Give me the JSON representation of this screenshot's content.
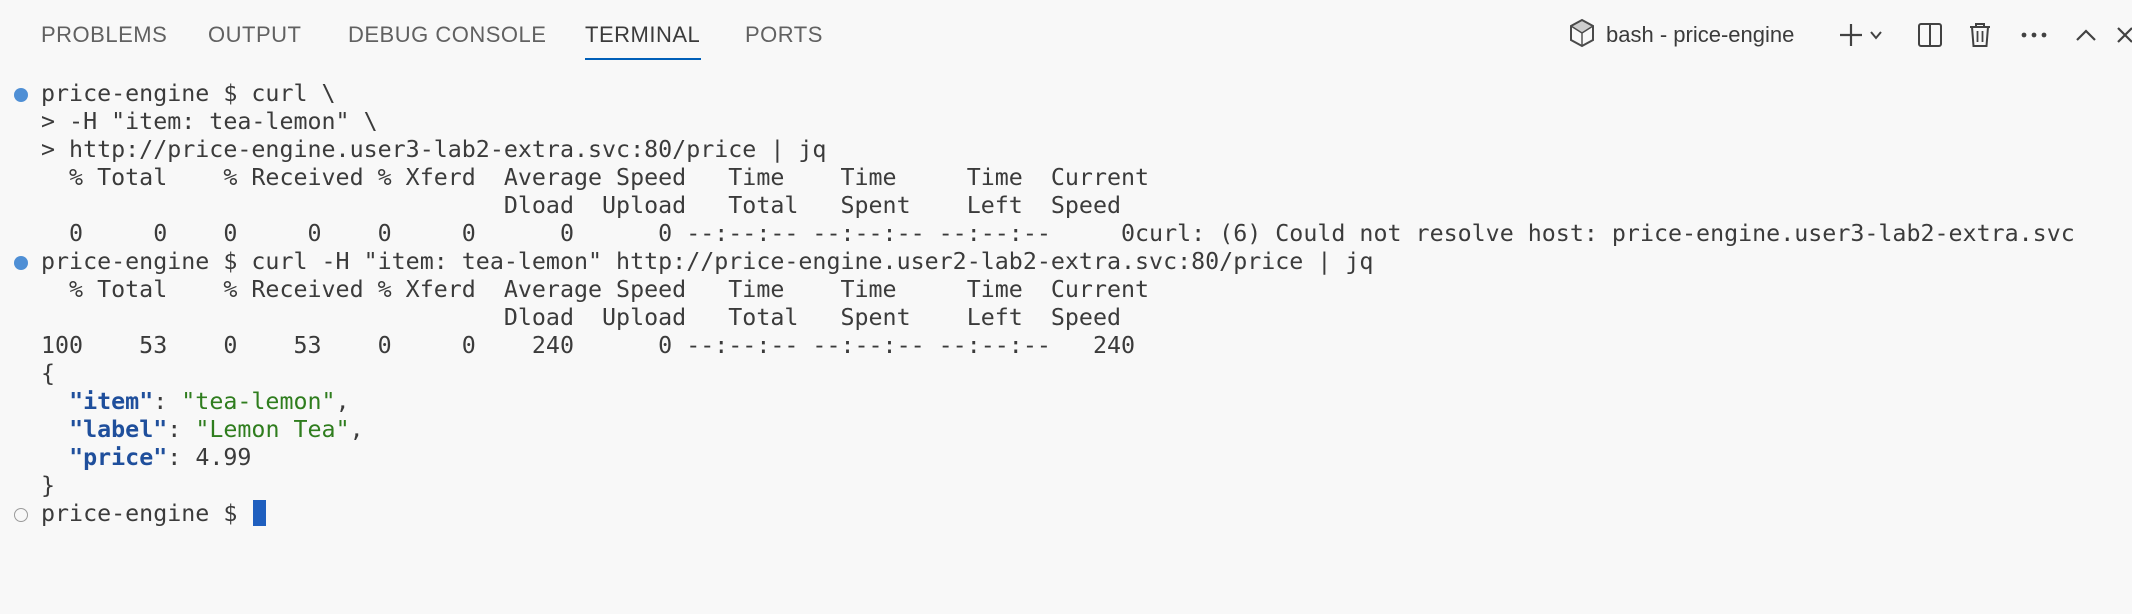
{
  "header": {
    "tabs": [
      {
        "label": "PROBLEMS",
        "active": false
      },
      {
        "label": "OUTPUT",
        "active": false
      },
      {
        "label": "DEBUG CONSOLE",
        "active": false
      },
      {
        "label": "TERMINAL",
        "active": true
      },
      {
        "label": "PORTS",
        "active": false
      }
    ],
    "terminal_selector": {
      "label": "bash - price-engine",
      "icon": "terminal-bash-icon"
    },
    "toolbar": [
      "new-terminal-plus-icon",
      "new-terminal-dropdown-chevron-icon",
      "split-terminal-icon",
      "kill-terminal-trash-icon",
      "more-actions-ellipsis-icon",
      "maximize-panel-chevron-up-icon",
      "close-panel-icon"
    ]
  },
  "terminal": {
    "lines": {
      "l1": "price-engine $ curl \\",
      "l2": "> -H \"item: tea-lemon\" \\",
      "l3": "> http://price-engine.user3-lab2-extra.svc:80/price | jq",
      "l4": "  % Total    % Received % Xferd  Average Speed   Time    Time     Time  Current",
      "l5": "                                 Dload  Upload   Total   Spent    Left  Speed",
      "l6": "  0     0    0     0    0     0      0      0 --:--:-- --:--:-- --:--:--     0curl: (6) Could not resolve host: price-engine.user3-lab2-extra.svc",
      "l7": "price-engine $ curl -H \"item: tea-lemon\" http://price-engine.user2-lab2-extra.svc:80/price | jq",
      "l8": "  % Total    % Received % Xferd  Average Speed   Time    Time     Time  Current",
      "l9": "                                 Dload  Upload   Total   Spent    Left  Speed",
      "l10": "100    53    0    53    0     0    240      0 --:--:-- --:--:-- --:--:--   240",
      "l11": "{",
      "l15": "}",
      "l16": "price-engine $ "
    },
    "json": {
      "indent": "  ",
      "item_key": "\"item\"",
      "item_sep": ": ",
      "item_val": "\"tea-lemon\"",
      "label_key": "\"label\"",
      "label_sep": ": ",
      "label_val": "\"Lemon Tea\"",
      "price_key": "\"price\"",
      "price_sep": ": ",
      "price_val": "4.99",
      "comma": ","
    },
    "colors": {
      "decoration_success": "#4f8fd5",
      "json_key": "#1f4f9c",
      "json_string": "#2f7d1e",
      "cursor": "#1f5fbf",
      "active_tab_underline": "#005fb8"
    }
  }
}
